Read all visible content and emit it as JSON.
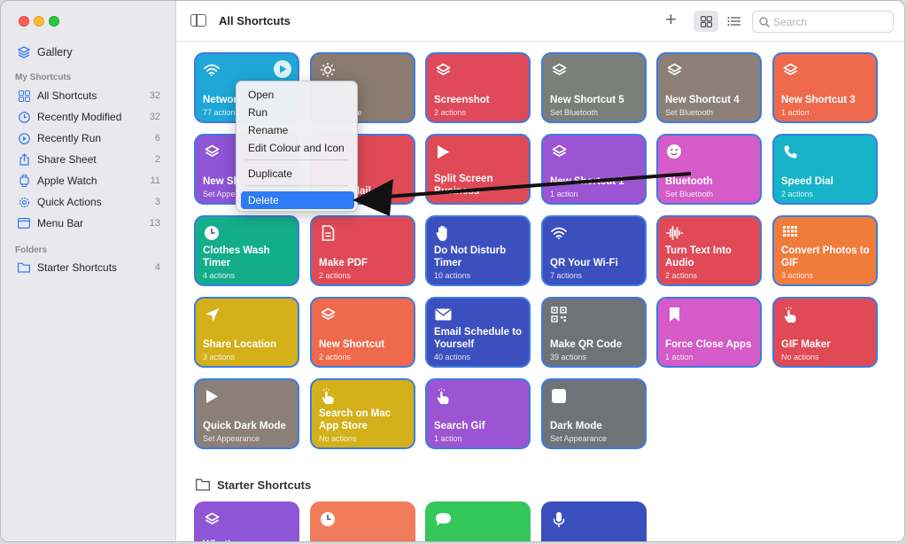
{
  "sidebar": {
    "gallery": "Gallery",
    "my_shortcuts_header": "My Shortcuts",
    "items": [
      {
        "label": "All Shortcuts",
        "count": "32",
        "icon": "grid-icon"
      },
      {
        "label": "Recently Modified",
        "count": "32",
        "icon": "clock-icon"
      },
      {
        "label": "Recently Run",
        "count": "6",
        "icon": "play-circle-icon"
      },
      {
        "label": "Share Sheet",
        "count": "2",
        "icon": "share-icon"
      },
      {
        "label": "Apple Watch",
        "count": "11",
        "icon": "watch-icon"
      },
      {
        "label": "Quick Actions",
        "count": "3",
        "icon": "gear-icon"
      },
      {
        "label": "Menu Bar",
        "count": "13",
        "icon": "menubar-icon"
      }
    ],
    "folders_header": "Folders",
    "folders": [
      {
        "label": "Starter Shortcuts",
        "count": "4",
        "icon": "folder-icon"
      }
    ]
  },
  "toolbar": {
    "title": "All Shortcuts",
    "search_placeholder": "Search"
  },
  "tiles": [
    {
      "name": "Network",
      "sub": "77 actions",
      "color": "#1fa7d8",
      "icon": "wifi"
    },
    {
      "name": "Mode",
      "sub": "Appearance",
      "color": "#8a7a70",
      "icon": "sun"
    },
    {
      "name": "Screenshot",
      "sub": "2 actions",
      "color": "#e0495a",
      "icon": "stack"
    },
    {
      "name": "New Shortcut 5",
      "sub": "Set Bluetooth",
      "color": "#7b7e7a",
      "icon": "stack"
    },
    {
      "name": "New Shortcut 4",
      "sub": "Set Bluetooth",
      "color": "#8b7f78",
      "icon": "stack"
    },
    {
      "name": "New Shortcut 3",
      "sub": "1 action",
      "color": "#ef6a4c",
      "icon": "stack"
    },
    {
      "name": "New Sh",
      "sub": "Set Appe",
      "color": "#8e55d6",
      "icon": "stack"
    },
    {
      "name": "Green Mail",
      "sub": "",
      "color": "#e04a56",
      "icon": "stack"
    },
    {
      "name": "Split Screen Business",
      "sub": "",
      "color": "#e04a56",
      "icon": "play"
    },
    {
      "name": "New Shortcut 1",
      "sub": "1 action",
      "color": "#9c55d2",
      "icon": "stack"
    },
    {
      "name": "Bluetooth",
      "sub": "Set Bluetooth",
      "color": "#d55bc8",
      "icon": "smile"
    },
    {
      "name": "Speed Dial",
      "sub": "2 actions",
      "color": "#17b3c9",
      "icon": "phone"
    },
    {
      "name": "Clothes Wash Timer",
      "sub": "4 actions",
      "color": "#13ad8a",
      "icon": "clock"
    },
    {
      "name": "Make PDF",
      "sub": "2 actions",
      "color": "#e04a56",
      "icon": "doc"
    },
    {
      "name": "Do Not Disturb Timer",
      "sub": "10 actions",
      "color": "#3b4fbf",
      "icon": "hand"
    },
    {
      "name": "QR Your Wi-Fi",
      "sub": "7 actions",
      "color": "#3b4fbf",
      "icon": "wifi"
    },
    {
      "name": "Turn Text Into Audio",
      "sub": "2 actions",
      "color": "#e04a56",
      "icon": "wave"
    },
    {
      "name": "Convert Photos to GIF",
      "sub": "3 actions",
      "color": "#f07c3c",
      "icon": "grid"
    },
    {
      "name": "Share Location",
      "sub": "3 actions",
      "color": "#d4b01a",
      "icon": "location"
    },
    {
      "name": "New Shortcut",
      "sub": "2 actions",
      "color": "#ef6a4c",
      "icon": "stack"
    },
    {
      "name": "Email Schedule to Yourself",
      "sub": "40 actions",
      "color": "#3b4fbf",
      "icon": "mail"
    },
    {
      "name": "Make QR Code",
      "sub": "39 actions",
      "color": "#6f7378",
      "icon": "qr"
    },
    {
      "name": "Force Close Apps",
      "sub": "1 action",
      "color": "#d55bc8",
      "icon": "bookmark"
    },
    {
      "name": "GIF Maker",
      "sub": "No actions",
      "color": "#e04a56",
      "icon": "tap"
    },
    {
      "name": "Quick Dark Mode",
      "sub": "Set Appearance",
      "color": "#8b7f78",
      "icon": "play"
    },
    {
      "name": "Search on Mac App Store",
      "sub": "No actions",
      "color": "#d4b01a",
      "icon": "tap"
    },
    {
      "name": "Search Gif",
      "sub": "1 action",
      "color": "#9c55d2",
      "icon": "tap"
    },
    {
      "name": "Dark Mode",
      "sub": "Set Appearance",
      "color": "#6f7378",
      "icon": "square"
    }
  ],
  "starter": {
    "title": "Starter Shortcuts",
    "tiles": [
      {
        "name": "What's a",
        "color": "#8e55d6",
        "icon": "stack"
      },
      {
        "name": "",
        "color": "#f07c5c",
        "icon": "clock"
      },
      {
        "name": "",
        "color": "#34c759",
        "icon": "bubble"
      },
      {
        "name": "",
        "color": "#3b4fbf",
        "icon": "mic"
      }
    ]
  },
  "context_menu": {
    "open": "Open",
    "run": "Run",
    "rename": "Rename",
    "edit": "Edit Colour and Icon",
    "duplicate": "Duplicate",
    "delete": "Delete"
  }
}
